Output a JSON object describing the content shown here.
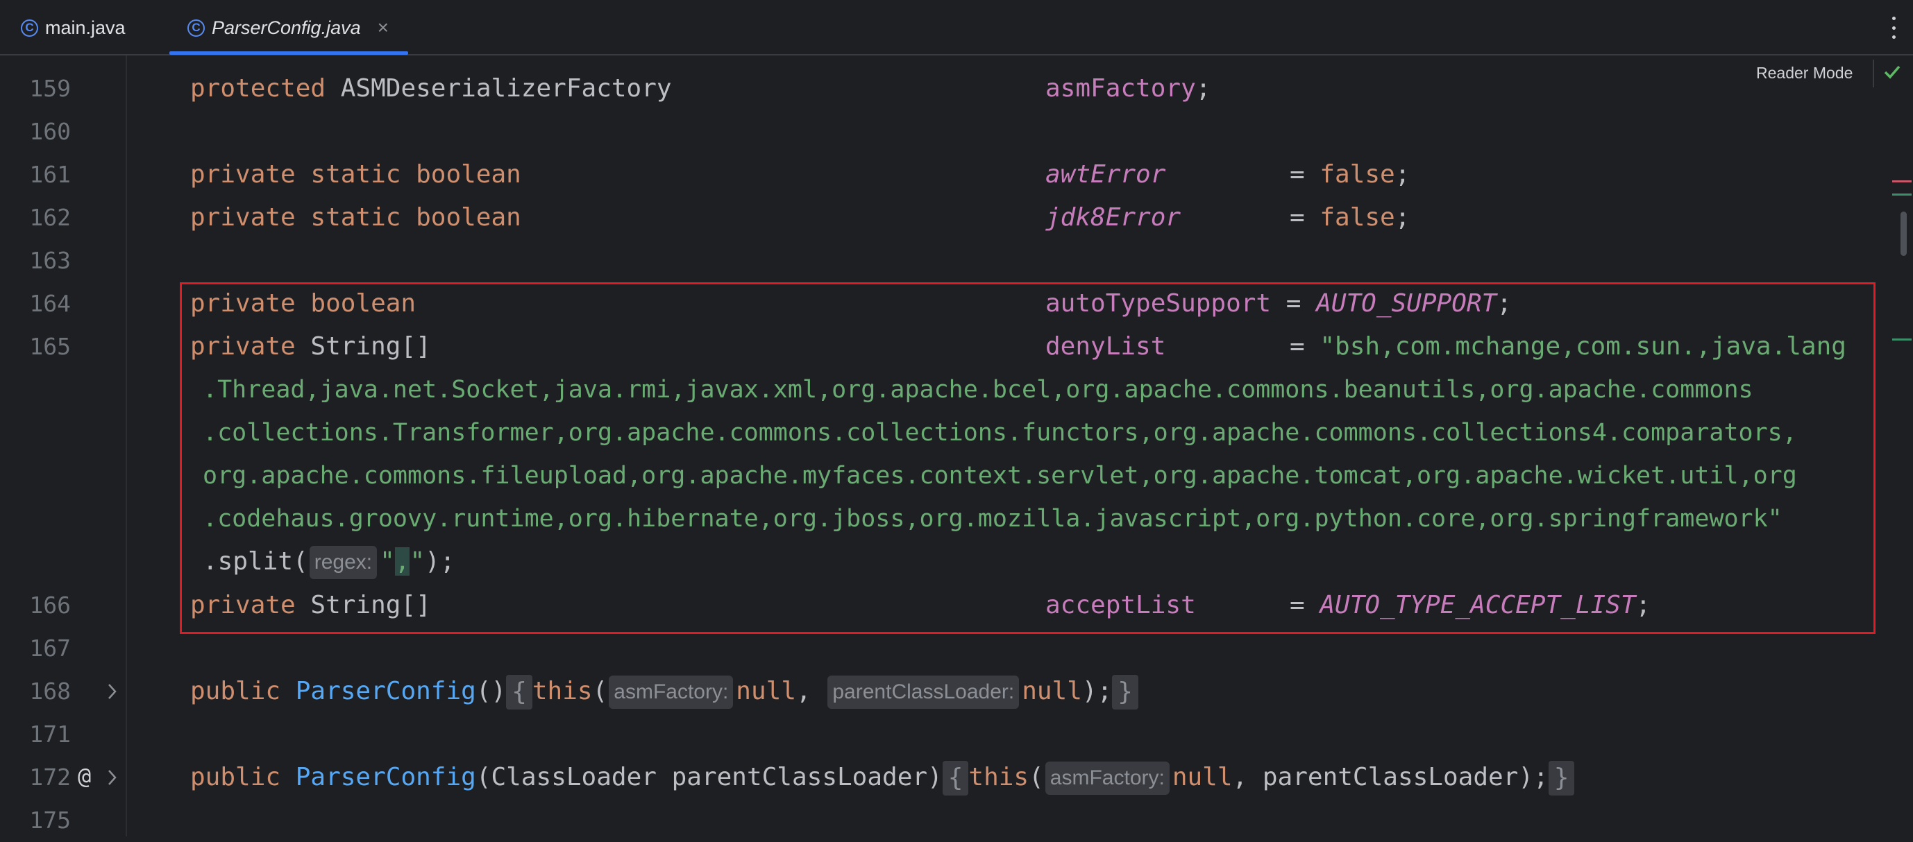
{
  "tabs": [
    {
      "label": "main.java",
      "icon": "class-icon",
      "active": false
    },
    {
      "label": "ParserConfig.java",
      "icon": "class-icon",
      "active": true,
      "close": "×"
    }
  ],
  "tab_icon_glyph": "C",
  "reader_mode": "Reader Mode",
  "gutter": {
    "l159": "159",
    "l160": "160",
    "l161": "161",
    "l162": "162",
    "l163": "163",
    "l164": "164",
    "l165": "165",
    "l166": "166",
    "l167": "167",
    "l168": "168",
    "l171": "171",
    "l172": "172",
    "l175": "175"
  },
  "code": {
    "l159": {
      "kw": "protected",
      "type": " ASMDeserializerFactory",
      "field": "asmFactory",
      "tail": ";"
    },
    "l161": {
      "kw": "private static boolean",
      "field": "awtError",
      "eq": "= ",
      "val": "false",
      "tail": ";"
    },
    "l162": {
      "kw": "private static boolean",
      "field": "jdk8Error",
      "eq": "= ",
      "val": "false",
      "tail": ";"
    },
    "l164": {
      "kw": "private boolean",
      "field": "autoTypeSupport",
      "eq": " = ",
      "val": "AUTO_SUPPORT",
      "tail": ";"
    },
    "l165": {
      "kw": "private",
      "type": " String[]",
      "field": "denyList",
      "eq": "= ",
      "str1": "\"bsh,com.mchange,com.sun.,java.lang",
      "str2": ".Thread,java.net.Socket,java.rmi,javax.xml,org.apache.bcel,org.apache.commons.beanutils,org.apache.commons",
      "str3": ".collections.Transformer,org.apache.commons.collections.functors,org.apache.commons.collections4.comparators,",
      "str4": "org.apache.commons.fileupload,org.apache.myfaces.context.servlet,org.apache.tomcat,org.apache.wicket.util,org",
      "str5": ".codehaus.groovy.runtime,org.hibernate,org.jboss,org.mozilla.javascript,org.python.core,org.springframework\"",
      "split_pre": ".split(",
      "hint": "regex:",
      "q1": "\"",
      "comma": ",",
      "q2": "\"",
      "split_post": ");"
    },
    "l166": {
      "kw": "private",
      "type": " String[]",
      "field": "acceptList",
      "eq": "= ",
      "val": "AUTO_TYPE_ACCEPT_LIST",
      "tail": ";"
    },
    "l168": {
      "kw": "public",
      "name": "ParserConfig",
      "parens": "()",
      "lbrace": "{",
      "this": "this",
      "open": "(",
      "hint1": "asmFactory:",
      "null1": "null",
      "comma": ",",
      "hint2": "parentClassLoader:",
      "null2": "null",
      "close": ");",
      "rbrace": "}"
    },
    "l172": {
      "kw": "public",
      "name": "ParserConfig",
      "params": "(ClassLoader parentClassLoader)",
      "lbrace": "{",
      "this": "this",
      "open": "(",
      "hint1": "asmFactory:",
      "null1": "null",
      "rest": ", parentClassLoader);",
      "rbrace": "}"
    }
  },
  "colors": {
    "keyword": "#cf8e6d",
    "field": "#c77dbb",
    "string": "#6aab73",
    "method": "#56a8f5",
    "highlight_box": "#e01b24",
    "tab_accent": "#3574f0"
  }
}
